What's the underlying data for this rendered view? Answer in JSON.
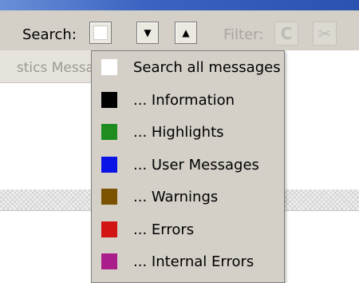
{
  "toolbar": {
    "search_label": "Search:",
    "filter_label": "Filter:",
    "down_arrow": "▼",
    "up_arrow": "▲",
    "refresh_glyph": "C",
    "clear_glyph": "✂",
    "selected_color": "#ffffff"
  },
  "tab": {
    "partial_label": "stics Messa"
  },
  "dropdown": {
    "items": [
      {
        "label": "Search all messages",
        "color": "#ffffff"
      },
      {
        "label": "... Information",
        "color": "#000000"
      },
      {
        "label": "... Highlights",
        "color": "#1e8c1e"
      },
      {
        "label": "... User Messages",
        "color": "#0a14e6"
      },
      {
        "label": "... Warnings",
        "color": "#7a5200"
      },
      {
        "label": "... Errors",
        "color": "#d21414"
      },
      {
        "label": "... Internal Errors",
        "color": "#aa1e8c"
      }
    ]
  }
}
